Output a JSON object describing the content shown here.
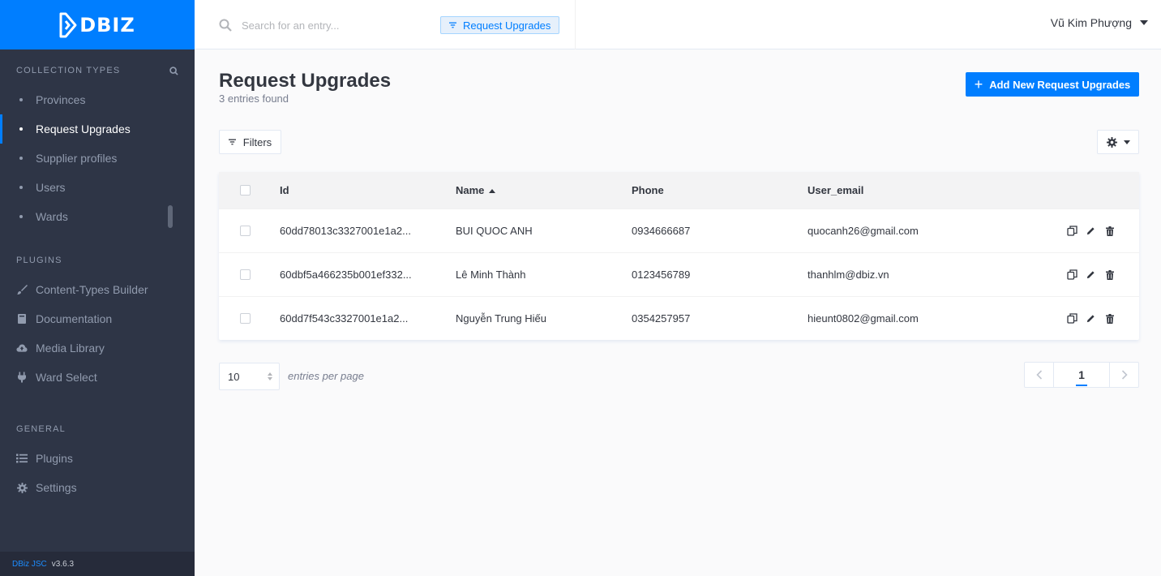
{
  "brand": {
    "name": "DBIZ"
  },
  "sidebar": {
    "collection_types_title": "COLLECTION TYPES",
    "collection_types": [
      {
        "label": "Provinces",
        "active": false
      },
      {
        "label": "Request Upgrades",
        "active": true
      },
      {
        "label": "Supplier profiles",
        "active": false
      },
      {
        "label": "Users",
        "active": false
      },
      {
        "label": "Wards",
        "active": false
      }
    ],
    "plugins_title": "PLUGINS",
    "plugins": [
      {
        "label": "Content-Types Builder",
        "icon": "paintbrush-icon"
      },
      {
        "label": "Documentation",
        "icon": "book-icon"
      },
      {
        "label": "Media Library",
        "icon": "cloud-upload-icon"
      },
      {
        "label": "Ward Select",
        "icon": "plug-icon"
      }
    ],
    "general_title": "GENERAL",
    "general": [
      {
        "label": "Plugins",
        "icon": "list-icon"
      },
      {
        "label": "Settings",
        "icon": "gear-icon"
      }
    ],
    "footer": {
      "company": "DBiz JSC",
      "version": "v3.6.3"
    }
  },
  "header": {
    "search_placeholder": "Search for an entry...",
    "search_chip": "Request Upgrades",
    "user_name": "Vũ Kim Phượng"
  },
  "main": {
    "title": "Request Upgrades",
    "subtitle": "3 entries found",
    "add_button": "Add New Request Upgrades",
    "filters_button": "Filters",
    "columns": {
      "id": "Id",
      "name": "Name",
      "phone": "Phone",
      "email": "User_email"
    },
    "rows": [
      {
        "id": "60dd78013c3327001e1a2...",
        "name": "BUI QUOC ANH",
        "phone": "0934666687",
        "email": "quocanh26@gmail.com"
      },
      {
        "id": "60dbf5a466235b001ef332...",
        "name": "Lê Minh Thành",
        "phone": "0123456789",
        "email": "thanhlm@dbiz.vn"
      },
      {
        "id": "60dd7f543c3327001e1a2...",
        "name": "Nguyễn Trung Hiếu",
        "phone": "0354257957",
        "email": "hieunt0802@gmail.com"
      }
    ],
    "per_page_value": "10",
    "per_page_label": "entries per page",
    "current_page": "1"
  },
  "colors": {
    "accent": "#007eff",
    "sidebar_bg": "#2e3546",
    "page_bg": "#fafafb"
  }
}
